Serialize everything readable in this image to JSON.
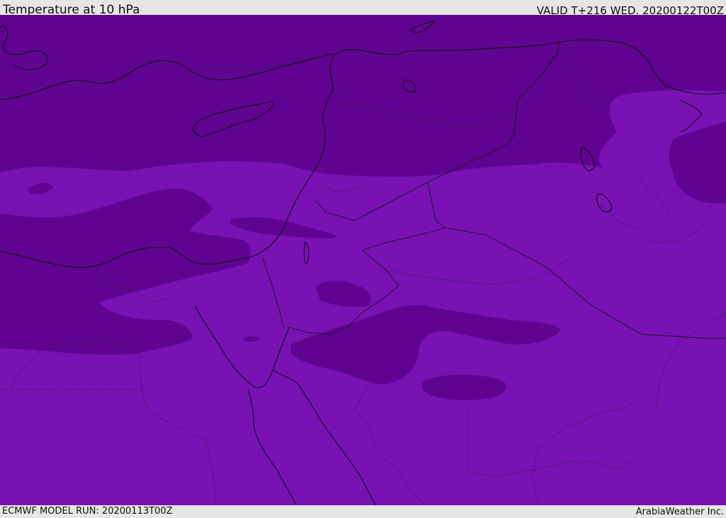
{
  "header": {
    "title": "Temperature at 10 hPa",
    "valid": "VALID T+216 WED. 20200122T00Z"
  },
  "footer": {
    "model_run": "ECMWF MODEL RUN: 20200113T00Z",
    "credit": "ArabiaWeather Inc."
  },
  "map": {
    "colors": {
      "band_dark": "#5f0490",
      "band_light": "#7812b3",
      "coastline": "#111111",
      "border": "#1a1a1a"
    }
  }
}
